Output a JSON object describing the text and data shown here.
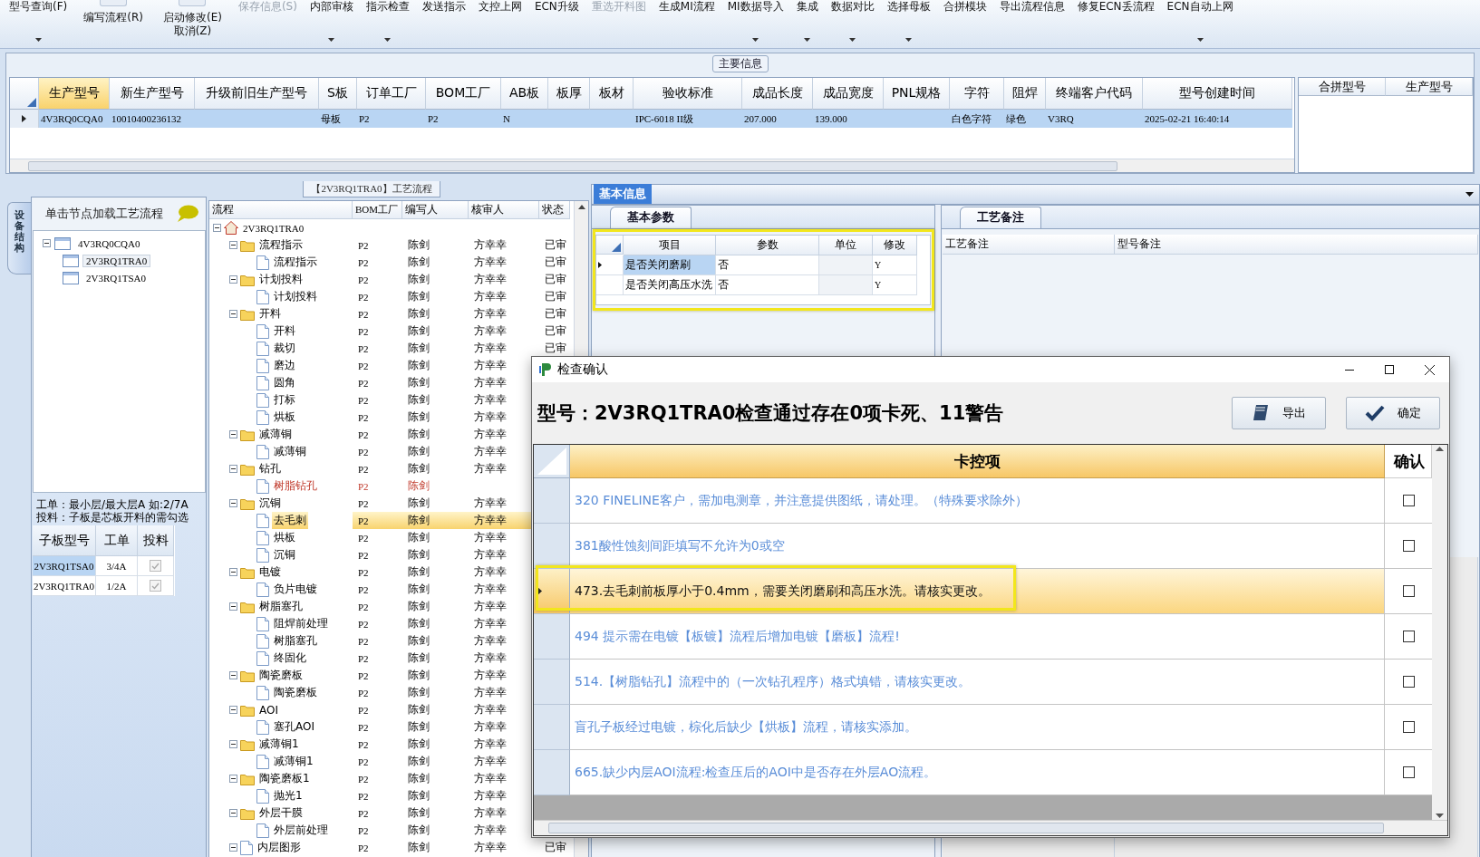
{
  "toolbar": {
    "items": [
      {
        "label": "型号查询(F)",
        "kind": "small",
        "dropdown": true,
        "disabled": false
      },
      {
        "label": "编写流程(R)",
        "kind": "large",
        "dropdown": false,
        "disabled": false
      },
      {
        "label": "启动修改(E)",
        "second_label": "取消(Z)",
        "kind": "large",
        "dropdown": false,
        "disabled": false
      },
      {
        "label": "保存信息(S)",
        "kind": "small",
        "dropdown": false,
        "disabled": true
      },
      {
        "label": "内部审核",
        "kind": "small",
        "dropdown": true,
        "disabled": false
      },
      {
        "label": "指示检查",
        "kind": "small",
        "dropdown": true,
        "disabled": false
      },
      {
        "label": "发送指示",
        "kind": "small",
        "dropdown": false,
        "disabled": false
      },
      {
        "label": "文控上网",
        "kind": "small",
        "dropdown": false,
        "disabled": false
      },
      {
        "label": "ECN升级",
        "kind": "small",
        "dropdown": false,
        "disabled": false
      },
      {
        "label": "重选开料图",
        "kind": "small",
        "dropdown": false,
        "disabled": true
      },
      {
        "label": "生成MI流程",
        "kind": "small",
        "dropdown": false,
        "disabled": false
      },
      {
        "label": "MI数据导入",
        "kind": "small",
        "dropdown": true,
        "disabled": false
      },
      {
        "label": "集成",
        "kind": "small",
        "dropdown": true,
        "disabled": false
      },
      {
        "label": "数据对比",
        "kind": "small",
        "dropdown": true,
        "disabled": false
      },
      {
        "label": "选择母板",
        "kind": "small",
        "dropdown": true,
        "disabled": false
      },
      {
        "label": "合拼模块",
        "kind": "small",
        "dropdown": false,
        "disabled": false
      },
      {
        "label": "导出流程信息",
        "kind": "small",
        "dropdown": false,
        "disabled": false
      },
      {
        "label": "修复ECN丢流程",
        "kind": "small",
        "dropdown": false,
        "disabled": false
      },
      {
        "label": "ECN自动上网",
        "kind": "small",
        "dropdown": true,
        "disabled": false
      }
    ]
  },
  "main_info": {
    "title": "主要信息",
    "columns": [
      {
        "label": "生产型号",
        "selected": true
      },
      {
        "label": "新生产型号",
        "selected": false
      },
      {
        "label": "升级前旧生产型号",
        "selected": false
      },
      {
        "label": "S板",
        "selected": false
      },
      {
        "label": "订单工厂",
        "selected": false
      },
      {
        "label": "BOM工厂",
        "selected": false
      },
      {
        "label": "AB板",
        "selected": false
      },
      {
        "label": "板厚",
        "selected": false
      },
      {
        "label": "板材",
        "selected": false
      },
      {
        "label": "验收标准",
        "selected": false
      },
      {
        "label": "成品长度",
        "selected": false
      },
      {
        "label": "成品宽度",
        "selected": false
      },
      {
        "label": "PNL规格",
        "selected": false
      },
      {
        "label": "字符",
        "selected": false
      },
      {
        "label": "阻焊",
        "selected": false
      },
      {
        "label": "终端客户代码",
        "selected": false
      },
      {
        "label": "型号创建时间",
        "selected": false
      }
    ],
    "rows": [
      {
        "selected": true,
        "cells": [
          "4V3RQ0CQA0",
          "10010400236132",
          null,
          "母板",
          "P2",
          "P2",
          "N",
          null,
          null,
          "IPC-6018 II级",
          "207.000",
          "139.000",
          null,
          "白色字符",
          "绿色",
          "V3RQ",
          "2025-02-21 16:40:14"
        ]
      }
    ],
    "merge_grid": {
      "columns": [
        "合拼型号",
        "生产型号"
      ]
    }
  },
  "structure_tab": {
    "label": "设备结构"
  },
  "board_tree": {
    "hint": "单击节点加载工艺流程",
    "nodes": [
      {
        "label": "4V3RQ0CQA0",
        "expanded": true,
        "selected": false,
        "children": [
          {
            "label": "2V3RQ1TRA0",
            "selected": true
          },
          {
            "label": "2V3RQ1TSA0",
            "selected": false
          }
        ]
      }
    ]
  },
  "note": [
    "工单：最小层/最大层A 如:2/7A",
    "投料：子板是芯板开料的需勾选"
  ],
  "sub_boards": {
    "columns": [
      "子板型号",
      "工单",
      "投料"
    ],
    "rows": [
      {
        "board": "2V3RQ1TSA0",
        "order": "3/4A",
        "feed": true,
        "selected": true
      },
      {
        "board": "2V3RQ1TRA0",
        "order": "1/2A",
        "feed": true,
        "selected": false
      }
    ]
  },
  "process_tree": {
    "tab_title": "【2V3RQ1TRA0】工艺流程",
    "columns": [
      "流程",
      "BOM工厂",
      "编写人",
      "核审人",
      "状态"
    ],
    "root": {
      "label": "2V3RQ1TRA0",
      "expanded": true,
      "selected": false,
      "error": false,
      "children": [
        {
          "label": "流程指示",
          "bom": "P2",
          "writer": "陈剑",
          "reviewer": "方幸幸",
          "status": "已审",
          "expanded": true,
          "selected": false,
          "error": false,
          "children": [
            {
              "label": "流程指示",
              "bom": "P2",
              "writer": "陈剑",
              "reviewer": "方幸幸",
              "status": "已审",
              "selected": false,
              "error": false
            }
          ]
        },
        {
          "label": "计划投料",
          "bom": "P2",
          "writer": "陈剑",
          "reviewer": "方幸幸",
          "status": "已审",
          "expanded": true,
          "selected": false,
          "error": false,
          "children": [
            {
              "label": "计划投料",
              "bom": "P2",
              "writer": "陈剑",
              "reviewer": "方幸幸",
              "status": "已审",
              "selected": false,
              "error": false
            }
          ]
        },
        {
          "label": "开料",
          "bom": "P2",
          "writer": "陈剑",
          "reviewer": "方幸幸",
          "status": "已审",
          "expanded": true,
          "selected": false,
          "error": false,
          "children": [
            {
              "label": "开料",
              "bom": "P2",
              "writer": "陈剑",
              "reviewer": "方幸幸",
              "status": "已审",
              "selected": false,
              "error": false
            },
            {
              "label": "裁切",
              "bom": "P2",
              "writer": "陈剑",
              "reviewer": "方幸幸",
              "status": "已审",
              "selected": false,
              "error": false
            },
            {
              "label": "磨边",
              "bom": "P2",
              "writer": "陈剑",
              "reviewer": "方幸幸",
              "selected": false,
              "error": false
            },
            {
              "label": "圆角",
              "bom": "P2",
              "writer": "陈剑",
              "reviewer": "方幸幸",
              "selected": false,
              "error": false
            },
            {
              "label": "打标",
              "bom": "P2",
              "writer": "陈剑",
              "reviewer": "方幸幸",
              "selected": false,
              "error": false
            },
            {
              "label": "烘板",
              "bom": "P2",
              "writer": "陈剑",
              "reviewer": "方幸幸",
              "selected": false,
              "error": false
            }
          ]
        },
        {
          "label": "减薄铜",
          "bom": "P2",
          "writer": "陈剑",
          "reviewer": "方幸幸",
          "expanded": true,
          "selected": false,
          "error": false,
          "children": [
            {
              "label": "减薄铜",
              "bom": "P2",
              "writer": "陈剑",
              "reviewer": "方幸幸",
              "selected": false,
              "error": false
            }
          ]
        },
        {
          "label": "钻孔",
          "bom": "P2",
          "writer": "陈剑",
          "reviewer": "方幸幸",
          "expanded": true,
          "selected": false,
          "error": false,
          "children": [
            {
              "label": "树脂钻孔",
              "bom": "P2",
              "writer": "陈剑",
              "selected": false,
              "error": true
            }
          ]
        },
        {
          "label": "沉铜",
          "bom": "P2",
          "writer": "陈剑",
          "reviewer": "方幸幸",
          "expanded": true,
          "selected": false,
          "error": false,
          "children": [
            {
              "label": "去毛刺",
              "bom": "P2",
              "writer": "陈剑",
              "reviewer": "方幸幸",
              "selected": true,
              "error": false
            },
            {
              "label": "烘板",
              "bom": "P2",
              "writer": "陈剑",
              "reviewer": "方幸幸",
              "selected": false,
              "error": false
            },
            {
              "label": "沉铜",
              "bom": "P2",
              "writer": "陈剑",
              "reviewer": "方幸幸",
              "selected": false,
              "error": false
            }
          ]
        },
        {
          "label": "电镀",
          "bom": "P2",
          "writer": "陈剑",
          "reviewer": "方幸幸",
          "expanded": true,
          "selected": false,
          "error": false,
          "children": [
            {
              "label": "负片电镀",
              "bom": "P2",
              "writer": "陈剑",
              "reviewer": "方幸幸",
              "selected": false,
              "error": false
            }
          ]
        },
        {
          "label": "树脂塞孔",
          "bom": "P2",
          "writer": "陈剑",
          "reviewer": "方幸幸",
          "expanded": true,
          "selected": false,
          "error": false,
          "children": [
            {
              "label": "阻焊前处理",
              "bom": "P2",
              "writer": "陈剑",
              "reviewer": "方幸幸",
              "selected": false,
              "error": false
            },
            {
              "label": "树脂塞孔",
              "bom": "P2",
              "writer": "陈剑",
              "reviewer": "方幸幸",
              "selected": false,
              "error": false
            },
            {
              "label": "终固化",
              "bom": "P2",
              "writer": "陈剑",
              "reviewer": "方幸幸",
              "selected": false,
              "error": false
            }
          ]
        },
        {
          "label": "陶瓷磨板",
          "bom": "P2",
          "writer": "陈剑",
          "reviewer": "方幸幸",
          "expanded": true,
          "selected": false,
          "error": false,
          "children": [
            {
              "label": "陶瓷磨板",
              "bom": "P2",
              "writer": "陈剑",
              "reviewer": "方幸幸",
              "selected": false,
              "error": false
            }
          ]
        },
        {
          "label": "AOI",
          "bom": "P2",
          "writer": "陈剑",
          "reviewer": "方幸幸",
          "expanded": true,
          "selected": false,
          "error": false,
          "children": [
            {
              "label": "塞孔AOI",
              "bom": "P2",
              "writer": "陈剑",
              "reviewer": "方幸幸",
              "selected": false,
              "error": false
            }
          ]
        },
        {
          "label": "减薄铜1",
          "bom": "P2",
          "writer": "陈剑",
          "reviewer": "方幸幸",
          "expanded": true,
          "selected": false,
          "error": false,
          "children": [
            {
              "label": "减薄铜1",
              "bom": "P2",
              "writer": "陈剑",
              "reviewer": "方幸幸",
              "selected": false,
              "error": false
            }
          ]
        },
        {
          "label": "陶瓷磨板1",
          "bom": "P2",
          "writer": "陈剑",
          "reviewer": "方幸幸",
          "expanded": true,
          "selected": false,
          "error": false,
          "children": [
            {
              "label": "抛光1",
              "bom": "P2",
              "writer": "陈剑",
              "reviewer": "方幸幸",
              "selected": false,
              "error": false
            }
          ]
        },
        {
          "label": "外层干膜",
          "bom": "P2",
          "writer": "陈剑",
          "reviewer": "方幸幸",
          "expanded": true,
          "selected": false,
          "error": false,
          "children": [
            {
              "label": "外层前处理",
              "bom": "P2",
              "writer": "陈剑",
              "reviewer": "方幸幸",
              "selected": false,
              "error": false
            }
          ]
        },
        {
          "label": "内层图形",
          "bom": "P2",
          "writer": "陈剑",
          "reviewer": "方幸幸",
          "status": "已审",
          "expanded": true,
          "selected": false,
          "error": false
        }
      ]
    }
  },
  "info_tabs": [
    {
      "label": "基本信息",
      "selected": true
    }
  ],
  "param_tabs": [
    {
      "label": "基本参数",
      "selected": true
    }
  ],
  "params": {
    "annotated": true,
    "columns": [
      "项目",
      "参数",
      "单位",
      "修改"
    ],
    "rows": [
      {
        "item": "是否关闭磨刷",
        "value": "否",
        "modify": "Y",
        "selected": true
      },
      {
        "item": "是否关闭高压水洗",
        "value": "否",
        "modify": "Y",
        "selected": false
      }
    ]
  },
  "remark_tabs": [
    {
      "label": "工艺备注",
      "selected": true
    }
  ],
  "remarks": {
    "columns": [
      "工艺备注",
      "型号备注"
    ]
  },
  "dialog": {
    "title": "检查确认",
    "heading": "型号：2V3RQ1TRA0检查通过存在0项卡死、11警告",
    "buttons": [
      {
        "label": "导出",
        "kind": "export"
      },
      {
        "label": "确定",
        "kind": "confirm"
      }
    ],
    "columns": [
      "卡控项",
      "确认"
    ],
    "rows": [
      {
        "text": "320 FINELINE客户，需加电测章，并注意提供图纸，请处理。（特殊要求除外）",
        "checked": false,
        "selected": false,
        "annotated": false
      },
      {
        "text": "381酸性蚀刻间距填写不允许为0或空",
        "checked": false,
        "selected": false,
        "annotated": false
      },
      {
        "text": "473.去毛刺前板厚小于0.4mm，需要关闭磨刷和高压水洗。请核实更改。",
        "checked": false,
        "selected": true,
        "annotated": true
      },
      {
        "text": "494 提示需在电镀【板镀】流程后增加电镀【磨板】流程!",
        "checked": false,
        "selected": false,
        "annotated": false
      },
      {
        "text": "514.【树脂钻孔】流程中的（一次钻孔程序）格式填错，请核实更改。",
        "checked": false,
        "selected": false,
        "annotated": false
      },
      {
        "text": "盲孔子板经过电镀，棕化后缺少【烘板】流程，请核实添加。",
        "checked": false,
        "selected": false,
        "annotated": false
      },
      {
        "text": "665.缺少内层AOI流程:检查压后的AOI中是否存在外层AO流程。",
        "checked": false,
        "selected": false,
        "annotated": false
      }
    ]
  }
}
